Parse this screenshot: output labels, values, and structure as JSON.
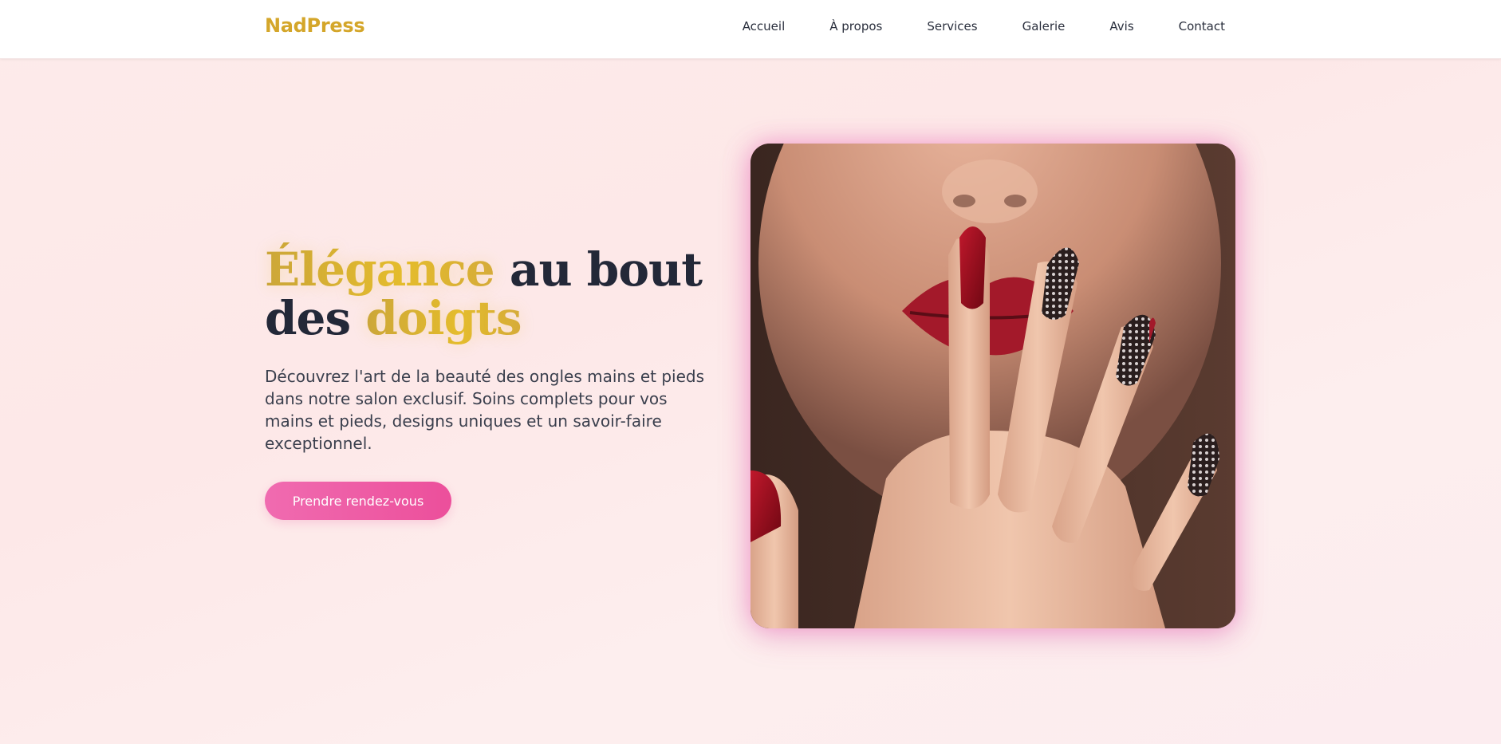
{
  "brand": {
    "name": "NadPress"
  },
  "nav": {
    "items": [
      {
        "label": "Accueil"
      },
      {
        "label": "À propos"
      },
      {
        "label": "Services"
      },
      {
        "label": "Galerie"
      },
      {
        "label": "Avis"
      },
      {
        "label": "Contact"
      }
    ]
  },
  "hero": {
    "title_part1": "Élégance",
    "title_part2": " au bout des ",
    "title_part3": "doigts",
    "description": "Découvrez l'art de la beauté des ongles mains et pieds dans notre salon exclusif. Soins complets pour vos mains et pieds, designs uniques et un savoir-faire exceptionnel.",
    "cta_label": "Prendre rendez-vous",
    "image_icon": "manicured-hand-photo"
  },
  "colors": {
    "brand_gold": "#d4a62a",
    "accent_pink": "#ec4f9b",
    "text_dark": "#232838"
  }
}
